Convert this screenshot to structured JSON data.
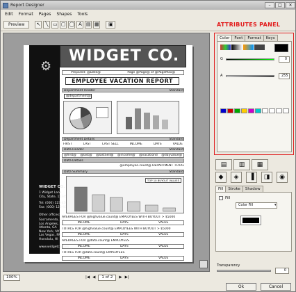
{
  "window": {
    "title": "Report Designer"
  },
  "menu": [
    "Edit",
    "Format",
    "Pages",
    "Shapes",
    "Tools"
  ],
  "toolbar": {
    "preview_label": "Preview",
    "tool_glyphs": [
      "↖",
      "╲",
      "▭",
      "▢",
      "◯",
      "A",
      "▤",
      "▦"
    ]
  },
  "report": {
    "company": "WIDGET CO.",
    "title": "EMPLOYEE VACATION REPORT",
    "prepared": "Prepared: @Date@",
    "page": "Page @Page@ of @PageMax@",
    "department_header": "Department Header",
    "standard": "Standard",
    "department_field": "@department@",
    "department_details": "Department Details",
    "columns": [
      "FIRST",
      "LAST",
      "LAST SELL",
      "INCOME",
      "DAYS",
      "VALUE"
    ],
    "data_header": "Data Header",
    "fields": [
      "@first@",
      "@last@",
      "@lastSell@",
      "@income@",
      "@vacationd",
      "@dayvalue@"
    ],
    "data_details": "Data Details",
    "summary_line": "@employee.count@ DEPARTMENT TOTAL",
    "data_summary": "Data Summary",
    "top_label": "TOP 10 BUYOUT VALUES",
    "avg1": "AVERAGES FOR @highvalue.count@ EMPLOYEES WITH BUYOUT > $5000",
    "totals1": "TOTALS FOR @highvalue.count@ EMPLOYEES WITH BUYOUT > $5000",
    "avg2": "AVERAGES FOR @data.count@ EMPLOYEES",
    "totals2": "TOTALS FOR @data.count@ EMPLOYEES",
    "sub_cols": [
      "INCOME",
      "DAYS",
      "VALUE"
    ],
    "sidebar_company": "WIDGET CO.",
    "sidebar_addr": "1 Widget Lane\nCity, State, 12345",
    "sidebar_phones": "Tel: (000) 123-4567\nFax: (000) 123-4568",
    "sidebar_offices_title": "Other offices:",
    "sidebar_offices": "Sacramento, CA\nLos Angeles, CA\nAtlanta, GA\nNew York, NY\nLas Vegas, NV\nHonolulu, HI",
    "sidebar_url": "www.widgetco.com",
    "bar_values": [
      70,
      48,
      40,
      28,
      18,
      10
    ]
  },
  "panel": {
    "label": "ATTRIBUTES PANEL",
    "tabs": [
      "Color",
      "Font",
      "Format",
      "Keys"
    ],
    "r_value": "0",
    "a_value": "255",
    "fill_tabs": [
      "Fill",
      "Stroke",
      "Shadow"
    ],
    "fill_check": "Fill",
    "fill_select": "Color Fill",
    "transparency_label": "Transparency",
    "transparency_value": "0"
  },
  "status": {
    "zoom": "100%",
    "page": "1 of 2"
  },
  "footer": {
    "ok": "Ok",
    "cancel": "Cancel"
  },
  "colors": {
    "accent": "#e21b1b"
  }
}
